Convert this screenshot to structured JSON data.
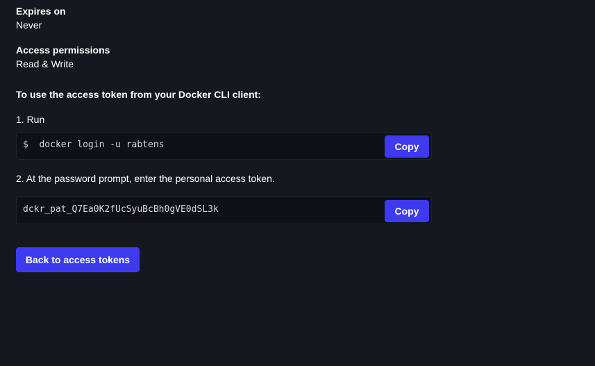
{
  "expires": {
    "label": "Expires on",
    "value": "Never"
  },
  "permissions": {
    "label": "Access permissions",
    "value": "Read & Write"
  },
  "instructions": {
    "heading": "To use the access token from your Docker CLI client:",
    "step1": "1. Run",
    "command": "$  docker login -u rabtens",
    "step2": "2. At the password prompt, enter the personal access token.",
    "token": "dckr_pat_Q7Ea0K2fUcSyuBcBh0gVE0dSL3k"
  },
  "buttons": {
    "copy_command": "Copy",
    "copy_token": "Copy",
    "back": "Back to access tokens"
  },
  "colors": {
    "background": "#15181e",
    "accent": "#3d3af0",
    "code_background": "#0f1116"
  }
}
